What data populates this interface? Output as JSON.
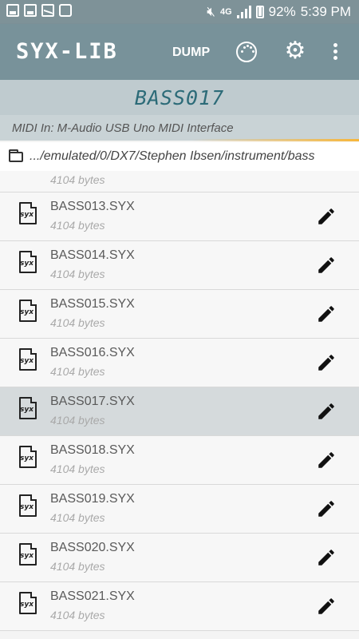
{
  "status": {
    "network": "4G",
    "battery": "92%",
    "time": "5:39 PM"
  },
  "appbar": {
    "title": "SYX-LIB",
    "dump_label": "DUMP",
    "midi_icon": "midi-connector-icon",
    "settings_icon": "gear-icon",
    "menu_icon": "more-vert-icon"
  },
  "patch": {
    "name": "BASS017"
  },
  "midi": {
    "label": "MIDI In: M-Audio USB Uno MIDI Interface"
  },
  "path": {
    "text": ".../emulated/0/DX7/Stephen Ibsen/instrument/bass"
  },
  "file_icon_label": "syx",
  "partial_row": {
    "size": "4104 bytes"
  },
  "files": [
    {
      "name": "BASS013.SYX",
      "size": "4104 bytes",
      "selected": false
    },
    {
      "name": "BASS014.SYX",
      "size": "4104 bytes",
      "selected": false
    },
    {
      "name": "BASS015.SYX",
      "size": "4104 bytes",
      "selected": false
    },
    {
      "name": "BASS016.SYX",
      "size": "4104 bytes",
      "selected": false
    },
    {
      "name": "BASS017.SYX",
      "size": "4104 bytes",
      "selected": true
    },
    {
      "name": "BASS018.SYX",
      "size": "4104 bytes",
      "selected": false
    },
    {
      "name": "BASS019.SYX",
      "size": "4104 bytes",
      "selected": false
    },
    {
      "name": "BASS020.SYX",
      "size": "4104 bytes",
      "selected": false
    },
    {
      "name": "BASS021.SYX",
      "size": "4104 bytes",
      "selected": false
    }
  ]
}
